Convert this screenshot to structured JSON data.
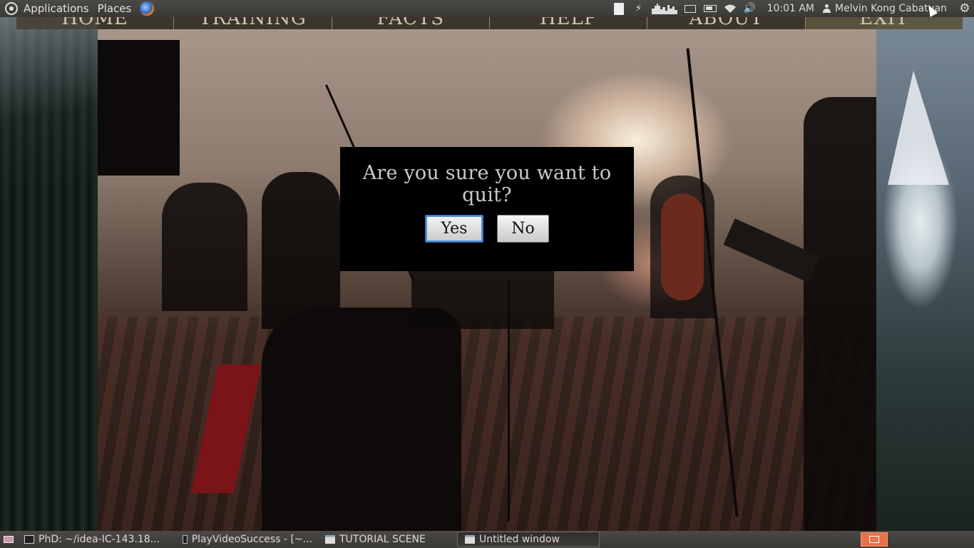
{
  "top_panel": {
    "applications_label": "Applications",
    "places_label": "Places",
    "clock": "10:01 AM",
    "user_name": "Melvin Kong Cabatuan",
    "tray_icons": [
      "document-icon",
      "bolt-icon",
      "weather-icon",
      "mail-icon",
      "battery-icon",
      "wifi-icon",
      "volume-icon"
    ]
  },
  "nav": {
    "items": [
      "HOME",
      "TRAINING",
      "FACTS",
      "HELP",
      "ABOUT",
      "EXIT"
    ]
  },
  "dialog": {
    "title": "Are you sure you want to quit?",
    "yes_label": "Yes",
    "no_label": "No"
  },
  "taskbar": {
    "tasks": [
      {
        "label": "PhD: ~/idea-IC-143.18...",
        "icon": "terminal-icon"
      },
      {
        "label": "PlayVideoSuccess - [~...",
        "icon": "intellij-icon"
      },
      {
        "label": "TUTORIAL SCENE",
        "icon": "window-icon"
      },
      {
        "label": "Untitled window",
        "icon": "window-icon"
      }
    ]
  },
  "colors": {
    "panel": "#3e3d3a",
    "dialog_bg": "#000000",
    "focus_ring": "#4a8fdc",
    "workspace": "#e8714a"
  }
}
